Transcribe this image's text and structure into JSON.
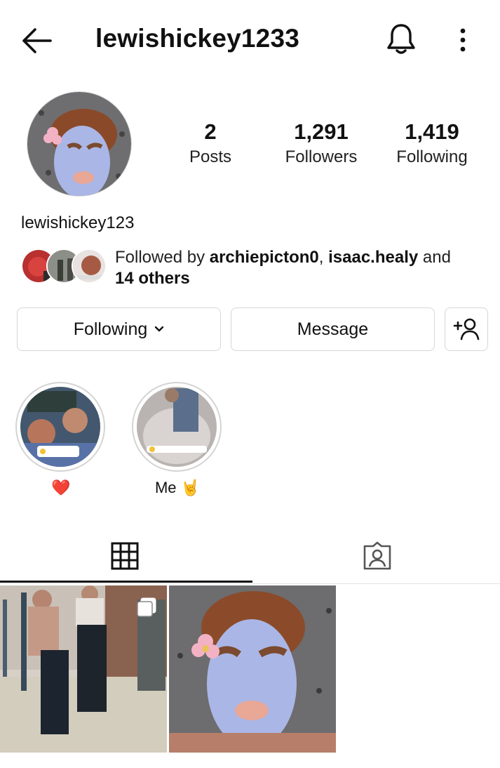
{
  "header": {
    "title": "lewishickey1233",
    "back_icon": "arrow-left-icon",
    "bell_icon": "bell-icon",
    "more_icon": "more-vertical-icon"
  },
  "profile": {
    "name": "lewishickey123",
    "stats": [
      {
        "value": "2",
        "label": "Posts"
      },
      {
        "value": "1,291",
        "label": "Followers"
      },
      {
        "value": "1,419",
        "label": "Following"
      }
    ],
    "followed_by": {
      "prefix": "Followed by ",
      "user1": "archiepicton0",
      "separator": ", ",
      "user2": "isaac.healy",
      "and_text": " and",
      "others": "14 others"
    }
  },
  "actions": {
    "following_label": "Following",
    "message_label": "Message",
    "add_user_icon": "add-person-icon"
  },
  "highlights": [
    {
      "label": "❤️"
    },
    {
      "label": "Me 🤘"
    }
  ],
  "tabs": [
    {
      "name": "posts-grid",
      "icon": "grid-icon",
      "active": true
    },
    {
      "name": "tagged",
      "icon": "tagged-person-icon",
      "active": false
    }
  ],
  "posts": [
    {
      "type": "carousel",
      "icon": "multiple-images-icon"
    },
    {
      "type": "single"
    }
  ],
  "colors": {
    "text": "#111111",
    "border": "#d6d6d6",
    "heart": "#e0142e",
    "mask": "#aab6e6"
  }
}
